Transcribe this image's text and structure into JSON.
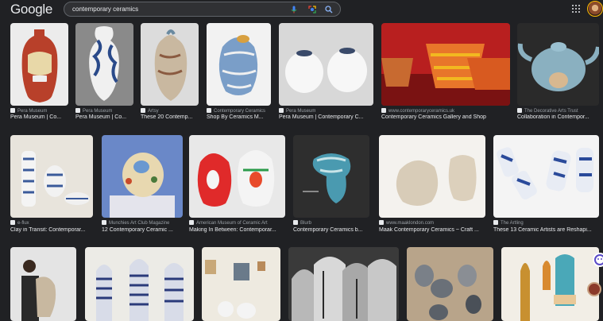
{
  "header": {
    "logo": "Google",
    "search_value": "contemporary ceramics",
    "icons": [
      "mic-icon",
      "lens-icon",
      "search-icon",
      "apps-icon",
      "avatar"
    ]
  },
  "results": [
    {
      "source": "Pera Museum",
      "title": "Pera Museum | Co..."
    },
    {
      "source": "Pera Museum",
      "title": "Pera Museum | Co..."
    },
    {
      "source": "Artsy",
      "title": "These 20 Contemp..."
    },
    {
      "source": "Contemporary Ceramics",
      "title": "Shop By Ceramics M..."
    },
    {
      "source": "Pera Museum",
      "title": "Pera Museum | Contemporary C..."
    },
    {
      "source": "www.contemporaryceramics.uk",
      "title": "Contemporary Ceramics Gallery and Shop"
    },
    {
      "source": "The Decorative Arts Trust",
      "title": "Collaboration in Contempor..."
    },
    {
      "source": "e-flux",
      "title": "Clay in Transit: Contemporar..."
    },
    {
      "source": "Munchies Art Club Magazine",
      "title": "12 Contemporary Ceramic ..."
    },
    {
      "source": "American Museum of Ceramic Art",
      "title": "Making In Between: Contemporar..."
    },
    {
      "source": "Blurb",
      "title": "Contemporary Ceramics b..."
    },
    {
      "source": "www.maaklondon.com",
      "title": "Maak Contemporary Ceramics ~ Craft ..."
    },
    {
      "source": "The Artling",
      "title": "These 13 Ceramic Artists are Reshapi..."
    }
  ]
}
